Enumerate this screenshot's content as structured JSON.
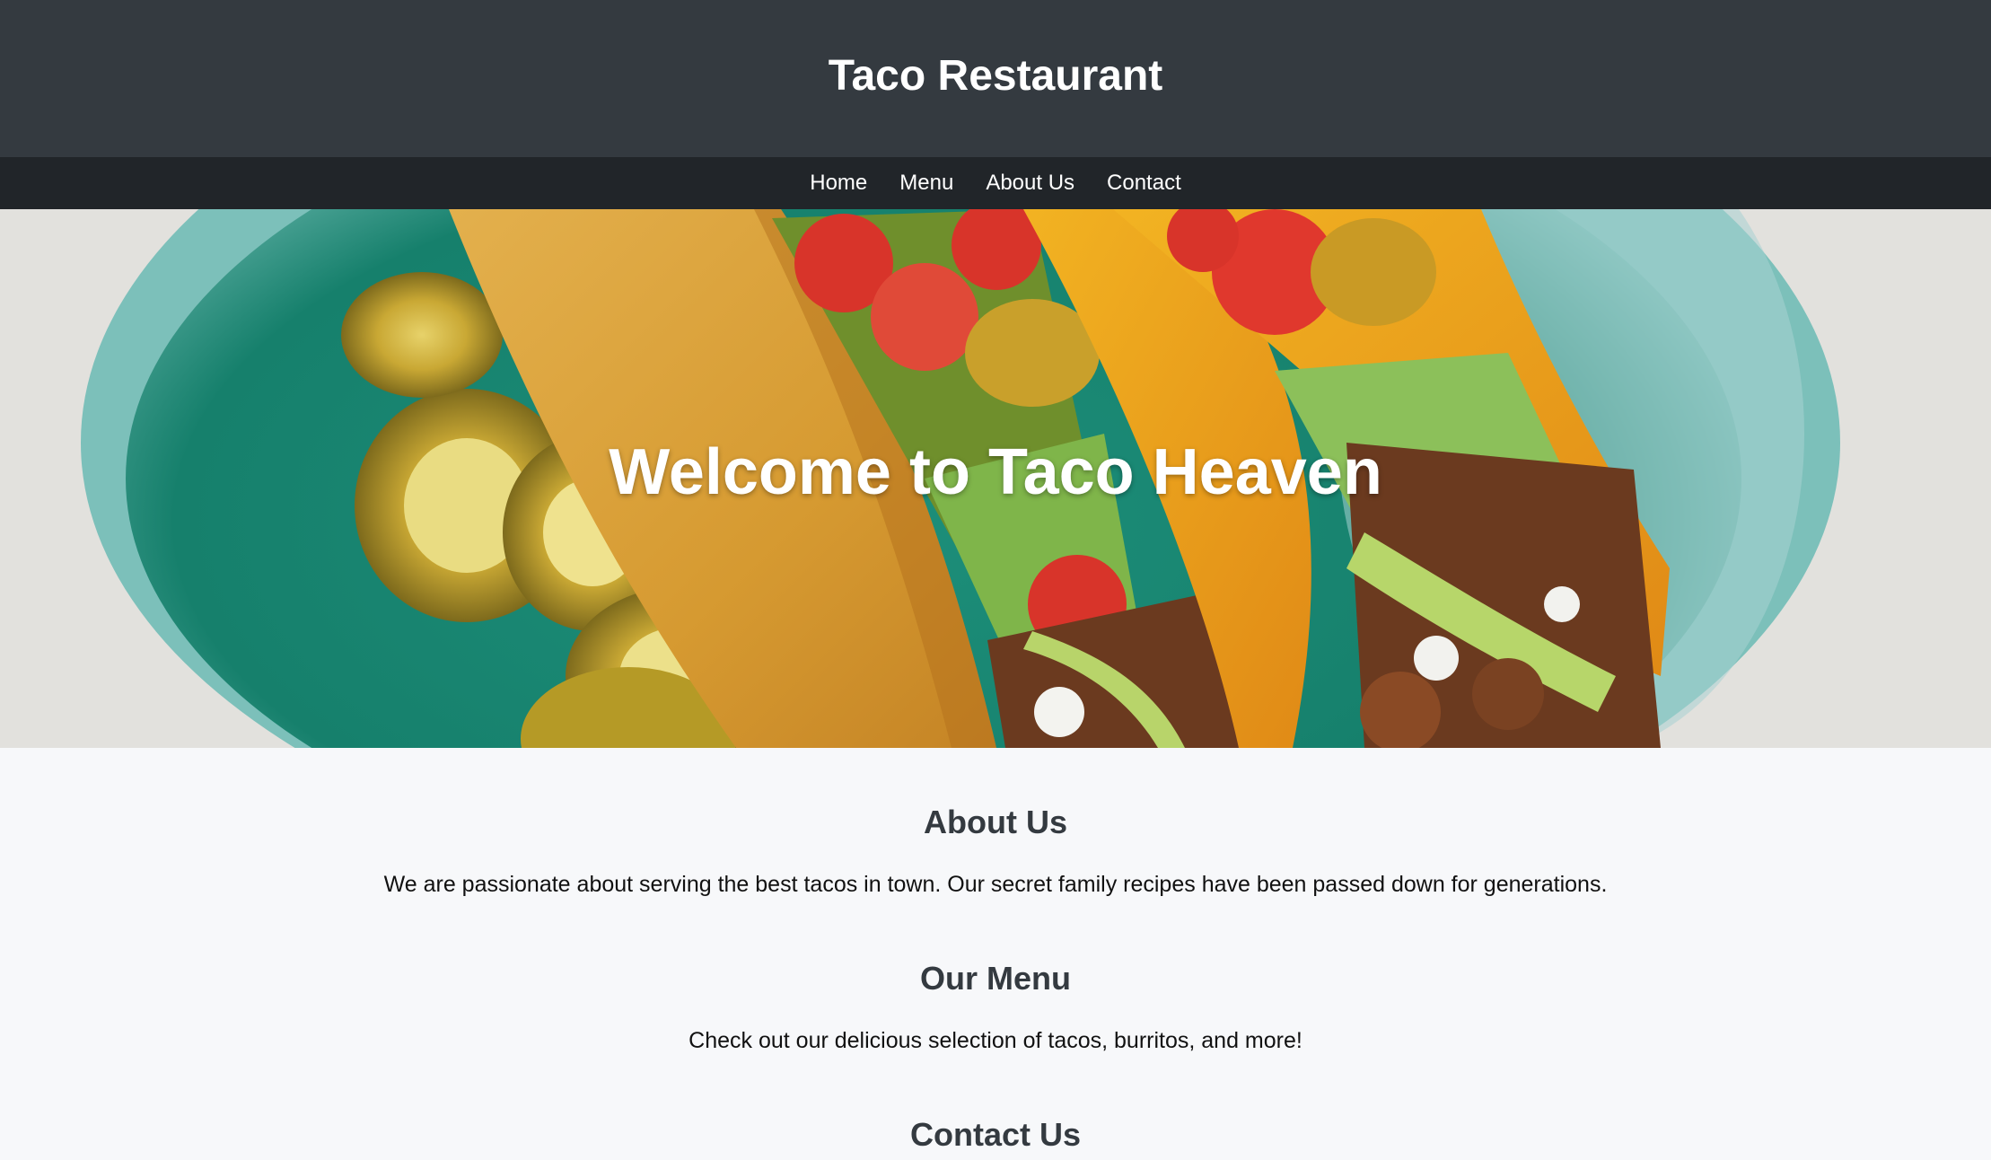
{
  "header": {
    "title": "Taco Restaurant"
  },
  "nav": {
    "items": [
      {
        "label": "Home"
      },
      {
        "label": "Menu"
      },
      {
        "label": "About Us"
      },
      {
        "label": "Contact"
      }
    ]
  },
  "hero": {
    "title": "Welcome to Taco Heaven"
  },
  "sections": {
    "about": {
      "heading": "About Us",
      "text": "We are passionate about serving the best tacos in town. Our secret family recipes have been passed down for generations."
    },
    "menu": {
      "heading": "Our Menu",
      "text": "Check out our delicious selection of tacos, burritos, and more!"
    },
    "contact": {
      "heading": "Contact Us"
    }
  },
  "colors": {
    "header_bg": "#343a40",
    "nav_bg": "#212529",
    "page_bg": "#f7f8fa",
    "heading_text": "#343a40"
  }
}
